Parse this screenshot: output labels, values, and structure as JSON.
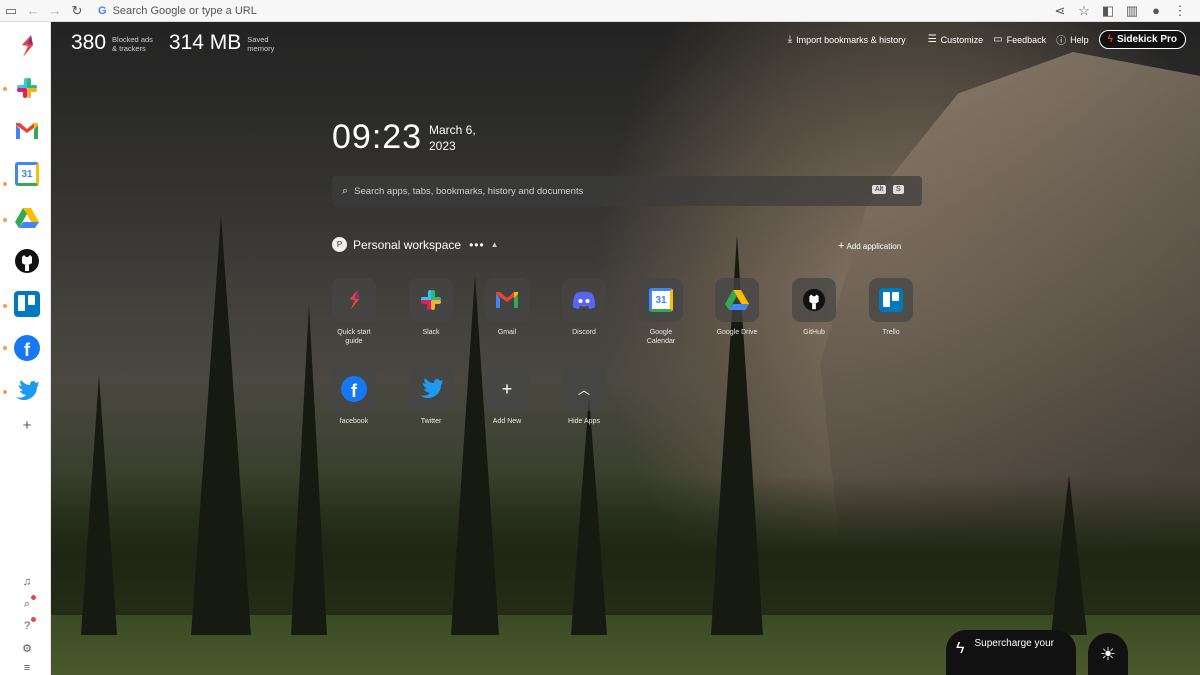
{
  "browser": {
    "omnibox_placeholder": "Search Google or type a URL"
  },
  "sidebar": {
    "apps": [
      "Sidekick",
      "Slack",
      "Gmail",
      "Google Calendar",
      "Google Drive",
      "GitHub",
      "Trello",
      "Facebook",
      "Twitter"
    ],
    "calendar_day": "31",
    "add_label": "+"
  },
  "stats": {
    "blocked_value": "380",
    "blocked_label_1": "Blocked ads",
    "blocked_label_2": "& trackers",
    "memory_value": "314 MB",
    "memory_label_1": "Saved",
    "memory_label_2": "memory"
  },
  "header": {
    "import_label": "Import bookmarks & history",
    "customize_label": "Customize",
    "feedback_label": "Feedback",
    "help_label": "Help",
    "pro_label": "Sidekick Pro"
  },
  "clock": {
    "time": "09:23",
    "date_line1": "March 6,",
    "date_line2": "2023"
  },
  "search": {
    "placeholder": "Search apps, tabs, bookmarks, history and documents",
    "shortcut_key1": "Alt",
    "shortcut_key2": "S"
  },
  "workspace": {
    "avatar_letter": "P",
    "title": "Personal workspace",
    "more": "•••",
    "add_application": "Add application"
  },
  "apps": [
    {
      "label1": "Quick start",
      "label2": "guide"
    },
    {
      "label1": "Slack",
      "label2": ""
    },
    {
      "label1": "Gmail",
      "label2": ""
    },
    {
      "label1": "Discord",
      "label2": ""
    },
    {
      "label1": "Google",
      "label2": "Calendar"
    },
    {
      "label1": "Google Drive",
      "label2": ""
    },
    {
      "label1": "GitHub",
      "label2": ""
    },
    {
      "label1": "Trello",
      "label2": ""
    },
    {
      "label1": "facebook",
      "label2": ""
    },
    {
      "label1": "Twitter",
      "label2": ""
    },
    {
      "label1": "Add New",
      "label2": ""
    },
    {
      "label1": "Hide Apps",
      "label2": ""
    }
  ],
  "footer": {
    "supercharge_line1": "Supercharge your"
  },
  "colors": {
    "sidekick_red": "#e8443a",
    "slack": "#4a154b",
    "facebook": "#1877f2",
    "twitter": "#1d9bf0",
    "trello": "#0079bf"
  }
}
